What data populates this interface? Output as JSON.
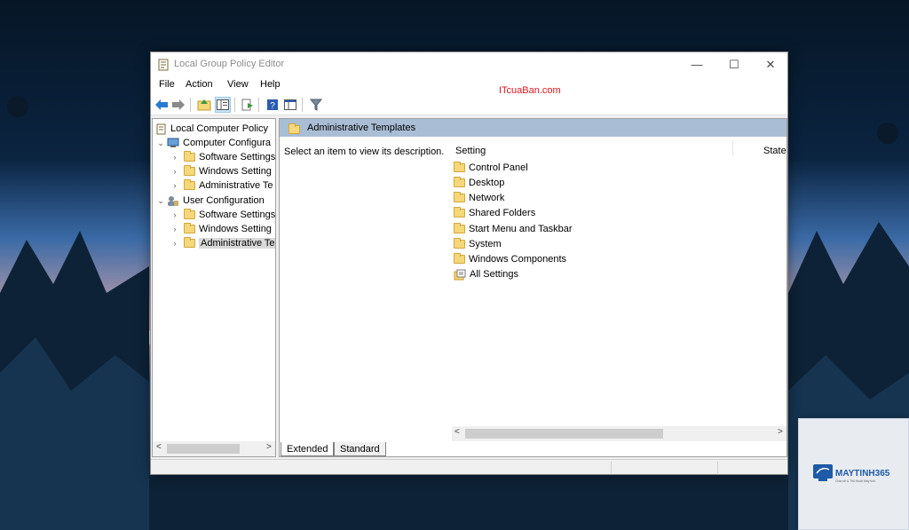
{
  "window": {
    "title": "Local Group Policy Editor",
    "controls": {
      "minimize": "—",
      "maximize": "☐",
      "close": "✕"
    }
  },
  "menu": {
    "file": "File",
    "action": "Action",
    "view": "View",
    "help": "Help"
  },
  "watermark": "ITcuaBan.com",
  "toolbar_icons": [
    "back-icon",
    "forward-icon",
    "up-folder-icon",
    "show-hide-tree-icon",
    "export-list-icon",
    "help-icon",
    "properties-icon",
    "filter-icon"
  ],
  "tree": {
    "root": "Local Computer Policy",
    "computer_config": "Computer Configura",
    "computer_children": [
      "Software Settings",
      "Windows Setting",
      "Administrative Te"
    ],
    "user_config": "User Configuration",
    "user_children": [
      "Software Settings",
      "Windows Setting",
      "Administrative Te"
    ]
  },
  "right_pane": {
    "header": "Administrative Templates",
    "description": "Select an item to view its description.",
    "columns": {
      "setting": "Setting",
      "state": "State"
    },
    "items": [
      "Control Panel",
      "Desktop",
      "Network",
      "Shared Folders",
      "Start Menu and Taskbar",
      "System",
      "Windows Components",
      "All Settings"
    ]
  },
  "tabs": {
    "extended": "Extended",
    "standard": "Standard"
  },
  "scroll_arrows": {
    "left": "<",
    "right": ">"
  },
  "logo": {
    "brand": "MAYTINH365",
    "tagline": "Chia sẻ & Thủ thuật Máy tính"
  },
  "colors": {
    "pane_header": "#a9bdd5",
    "watermark": "#e0141f",
    "folder": "#f6d77a"
  }
}
